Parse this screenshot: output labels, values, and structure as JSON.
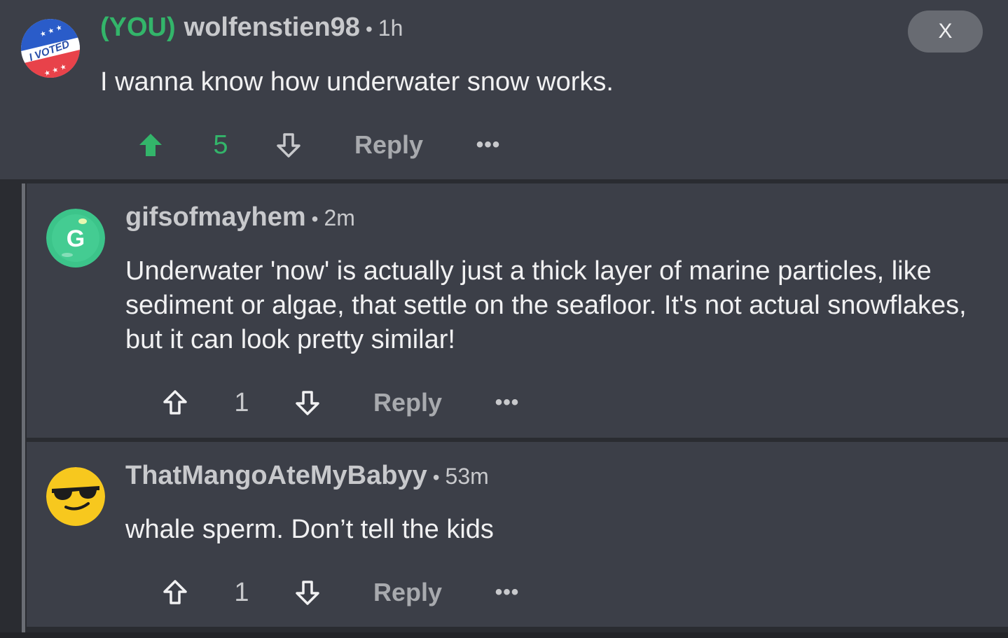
{
  "top_comment": {
    "you_tag": "(YOU)",
    "username": "wolfenstien98",
    "separator": "•",
    "time": "1h",
    "body": "I wanna know how underwater snow works.",
    "vote_count": "5",
    "reply_label": "Reply",
    "more_label": "•••",
    "close_label": "X",
    "avatar_text": "I VOTED",
    "upvoted": true,
    "accent_color": "#33b56a"
  },
  "replies": [
    {
      "username": "gifsofmayhem",
      "separator": "•",
      "time": "2m",
      "body": "Underwater 'now' is actually just a thick layer of marine particles, like sediment or algae, that settle on the seafloor. It's not actual snowflakes, but it can look pretty similar!",
      "vote_count": "1",
      "reply_label": "Reply",
      "more_label": "•••",
      "avatar_letter": "G",
      "avatar_color": "#3cc48a"
    },
    {
      "username": "ThatMangoAteMyBabyy",
      "separator": "•",
      "time": "53m",
      "body": "whale sperm. Don’t tell the kids",
      "vote_count": "1",
      "reply_label": "Reply",
      "more_label": "•••",
      "avatar_icon": "sunglasses-face-icon",
      "avatar_color": "#f7c81e"
    }
  ]
}
